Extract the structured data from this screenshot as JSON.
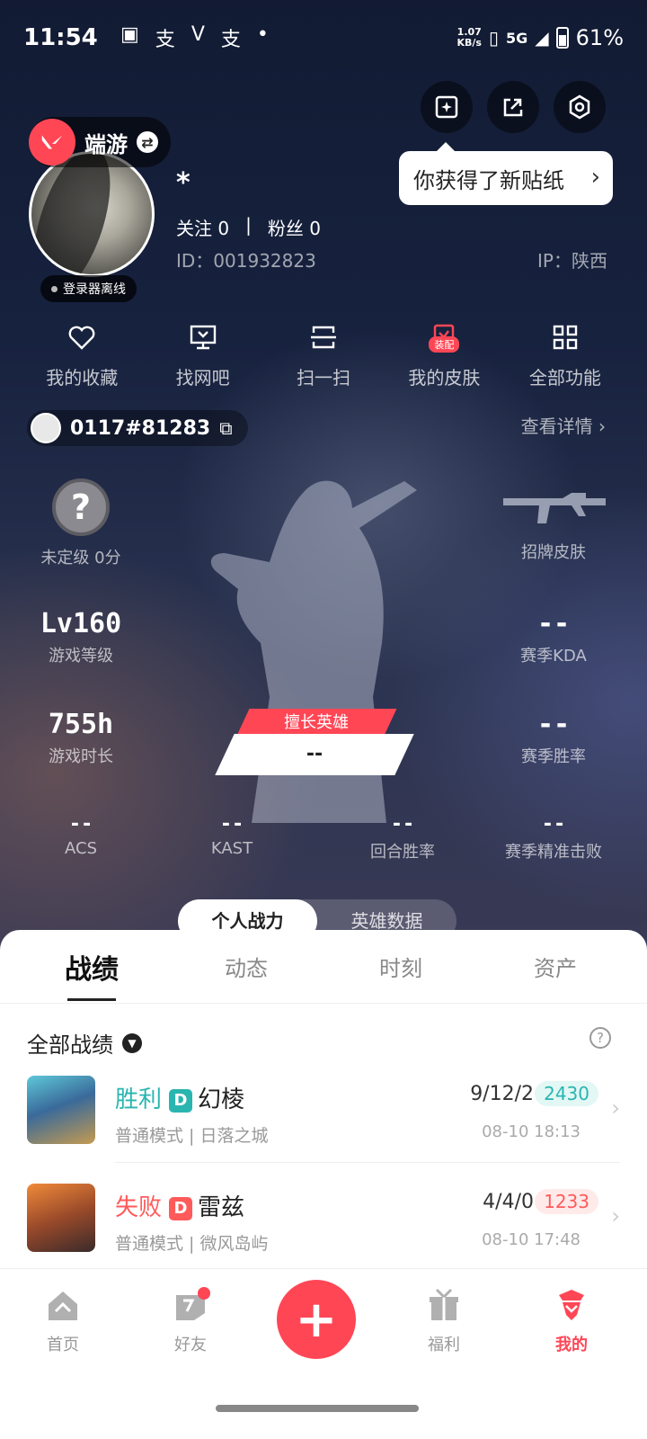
{
  "status_bar": {
    "time": "11:54",
    "speed_top": "1.07",
    "speed_unit": "KB/s",
    "network": "5G",
    "battery": "61%"
  },
  "header": {
    "game_name": "端游",
    "tooltip": "你获得了新贴纸"
  },
  "profile": {
    "username": "*",
    "follow_label": "关注",
    "follow_count": "0",
    "fans_label": "粉丝",
    "fans_count": "0",
    "separator": "|",
    "id_text": "ID：001932823",
    "ip_text": "IP：陕西",
    "online_status": "登录器离线"
  },
  "quick_actions": [
    {
      "label": "我的收藏",
      "icon": "heart-icon"
    },
    {
      "label": "找网吧",
      "icon": "monitor-icon"
    },
    {
      "label": "扫一扫",
      "icon": "scan-icon"
    },
    {
      "label": "我的皮肤",
      "icon": "skin-icon",
      "badge": "装配"
    },
    {
      "label": "全部功能",
      "icon": "grid-icon"
    }
  ],
  "riot_id": "0117#81283",
  "view_details": "查看详情",
  "stats": {
    "rank": {
      "icon_text": "?",
      "label": "未定级 0分"
    },
    "skin": {
      "label": "招牌皮肤"
    },
    "level": {
      "value": "Lv160",
      "label": "游戏等级"
    },
    "kda": {
      "value": "--",
      "label": "赛季KDA"
    },
    "hours": {
      "value": "755h",
      "label": "游戏时长"
    },
    "winrate": {
      "value": "--",
      "label": "赛季胜率"
    },
    "hero_tag": "擅长英雄",
    "hero_value": "--",
    "acs": {
      "value": "--",
      "label": "ACS"
    },
    "kast": {
      "value": "--",
      "label": "KAST"
    },
    "round_win": {
      "value": "--",
      "label": "回合胜率"
    },
    "precision": {
      "value": "--",
      "label": "赛季精准击败"
    }
  },
  "toggle": {
    "active": "个人战力",
    "inactive": "英雄数据"
  },
  "tabs": [
    "战绩",
    "动态",
    "时刻",
    "资产"
  ],
  "filter_label": "全部战绩",
  "help_icon": "?",
  "matches": [
    {
      "result": "胜利",
      "result_color": "#2ab5b0",
      "badge": "D",
      "agent": "幻棱",
      "mode": "普通模式 | 日落之城",
      "kda": "9/12/2",
      "score": "2430",
      "score_color": "#2ab5b0",
      "score_bg": "#e3f7f5",
      "date": "08-10 18:13"
    },
    {
      "result": "失败",
      "result_color": "#ff5a5a",
      "badge": "D",
      "agent": "雷兹",
      "mode": "普通模式 | 微风岛屿",
      "kda": "4/4/0",
      "score": "1233",
      "score_color": "#ff5a5a",
      "score_bg": "#ffeaea",
      "date": "08-10 17:48"
    }
  ],
  "nav": [
    {
      "label": "首页",
      "icon": "home-icon"
    },
    {
      "label": "好友",
      "icon": "friends-icon"
    },
    {
      "label": "福利",
      "icon": "gift-icon"
    },
    {
      "label": "我的",
      "icon": "profile-icon"
    }
  ],
  "colors": {
    "accent": "#ff4655"
  }
}
